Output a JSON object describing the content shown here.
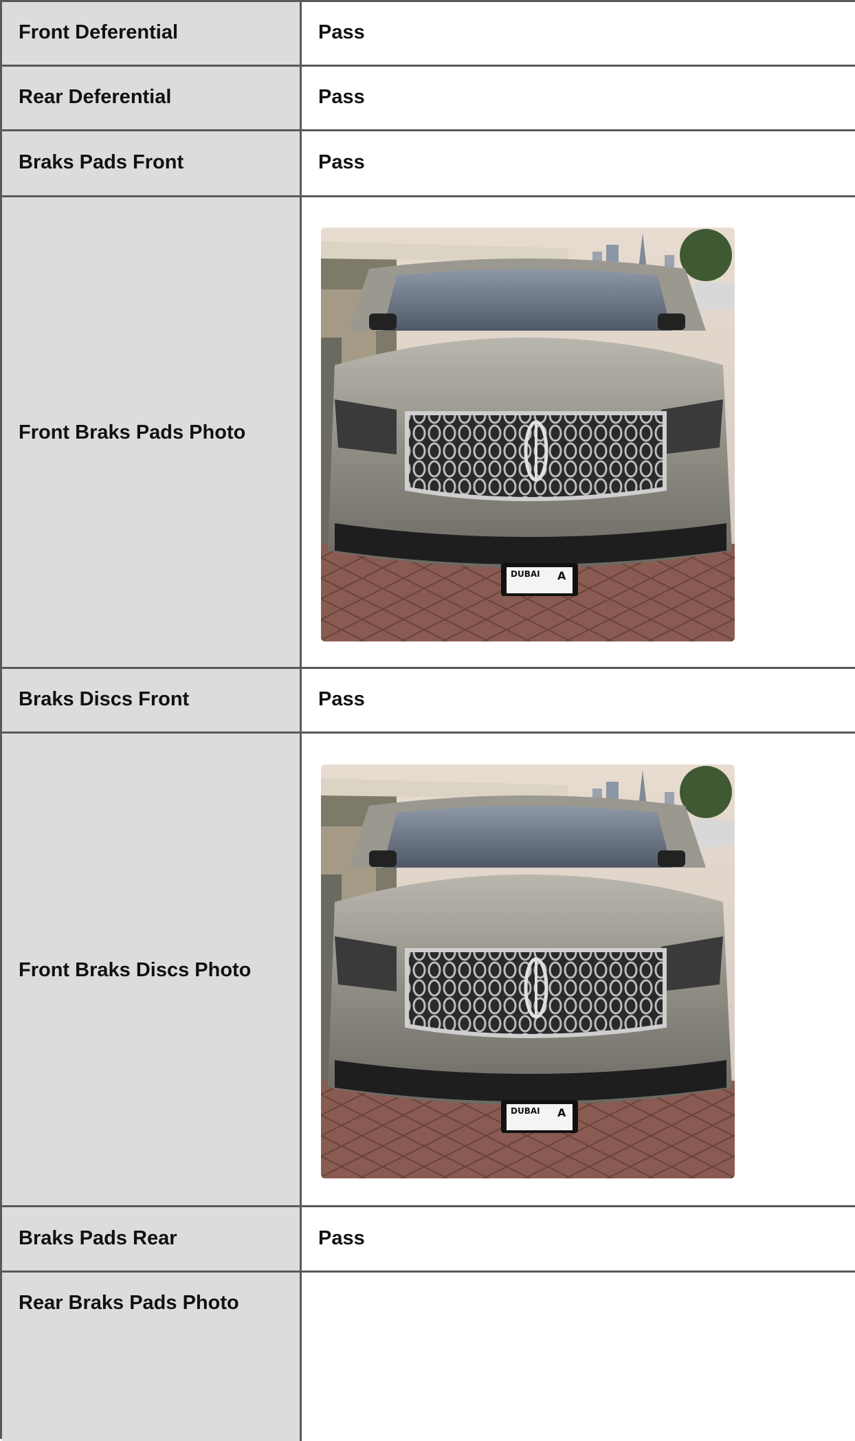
{
  "rows": [
    {
      "label": "Front Deferential",
      "value": "Pass"
    },
    {
      "label": "Rear Deferential",
      "value": "Pass"
    },
    {
      "label": "Braks Pads Front",
      "value": "Pass"
    },
    {
      "label": "Front Braks Pads Photo",
      "photo": "silver-lincoln-suv-front-photo"
    },
    {
      "label": "Braks Discs Front",
      "value": "Pass"
    },
    {
      "label": "Front Braks Discs Photo",
      "photo": "silver-lincoln-suv-front-photo"
    },
    {
      "label": "Braks Pads Rear",
      "value": "Pass"
    },
    {
      "label": "Rear Braks Pads Photo"
    }
  ],
  "plate": {
    "city": "DUBAI",
    "letter": "A"
  }
}
